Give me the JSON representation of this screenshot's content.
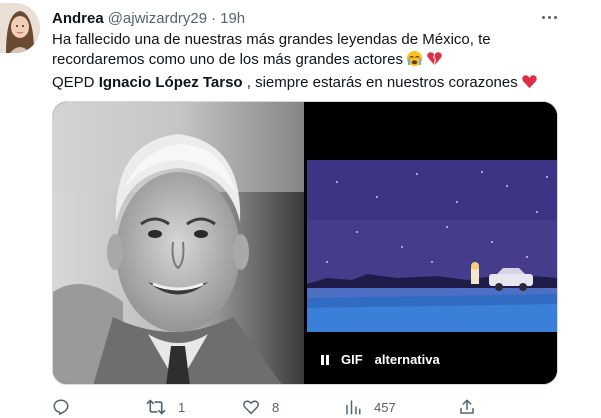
{
  "tweet": {
    "author_name": "Andrea",
    "author_handle": "@ajwizardry29",
    "separator": "·",
    "time": "19h",
    "text_line1": "Ha fallecido una de nuestras más grandes leyendas de México, te",
    "text_line2": "recordaremos como uno de los más grandes actores",
    "text_line3_prefix": "QEPD ",
    "text_line3_bold": "Ignacio López Tarso",
    "text_line3_suffix": " , siempre estarás en nuestros corazones",
    "emojis": [
      "crying-face-emoji",
      "broken-heart-emoji",
      "red-heart-emoji"
    ]
  },
  "media": {
    "gif_badge": "GIF",
    "gif_alt_label": "alternativa"
  },
  "actions": {
    "reply_count": "",
    "retweet_count": "1",
    "like_count": "8",
    "views_count": "457"
  },
  "colors": {
    "text": "#0f1419",
    "secondary": "#536471",
    "heart": "#e0245e",
    "border": "#cfd9de"
  }
}
